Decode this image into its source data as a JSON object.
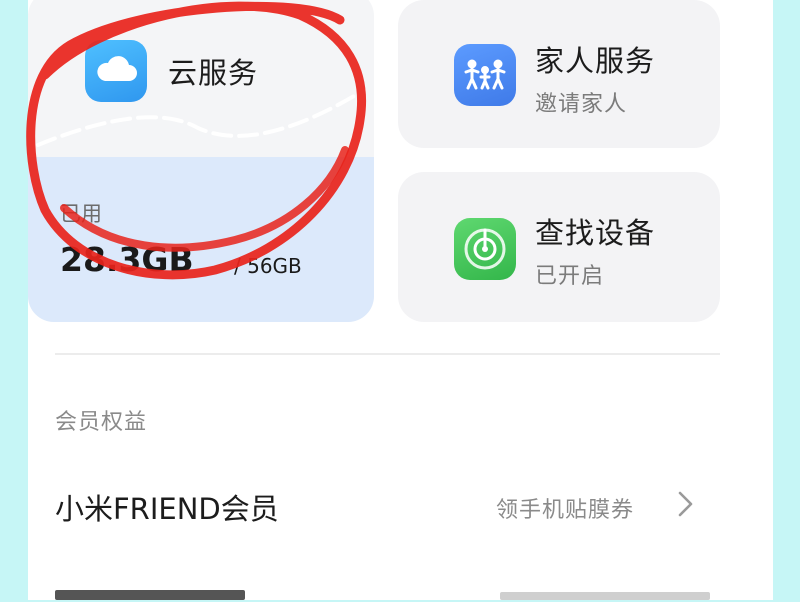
{
  "cloud_service": {
    "title": "云服务",
    "used_label": "已用",
    "used_value": "28.3GB",
    "total_value": "/ 56GB",
    "icon": "cloud-icon"
  },
  "family_service": {
    "title": "家人服务",
    "subtitle": "邀请家人",
    "icon": "family-icon"
  },
  "find_device": {
    "title": "查找设备",
    "subtitle": "已开启",
    "icon": "radar-icon"
  },
  "membership": {
    "section_label": "会员权益",
    "row_title": "小米FRIEND会员",
    "row_value": "领手机贴膜券",
    "chevron": "chevron-right-icon"
  },
  "colors": {
    "cloud_icon": "#3ba9f5",
    "family_icon": "#4a86f0",
    "find_icon": "#43c65a",
    "annotation": "#e8231b"
  }
}
